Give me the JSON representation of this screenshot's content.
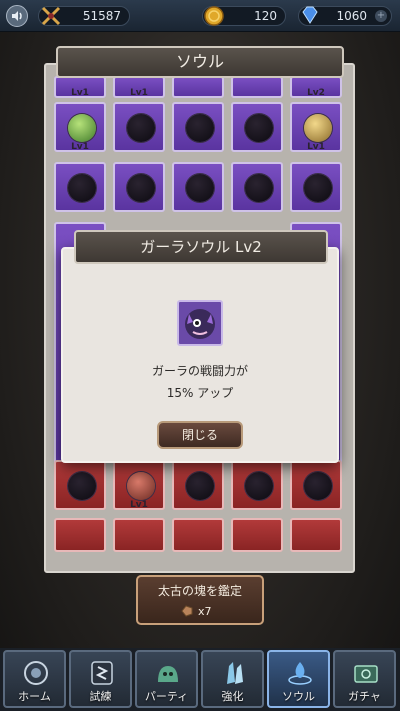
{
  "topbar": {
    "power": "51587",
    "gold": "120",
    "gems": "1060",
    "gem_plus": "+"
  },
  "panel": {
    "title": "ソウル"
  },
  "grid": {
    "lv_label": "Lv1",
    "lv2_label": "Lv2"
  },
  "modal": {
    "title": "ガーラソウル Lv2",
    "line1": "ガーラの戦闘力が",
    "line2": "15% アップ",
    "close_label": "閉じる"
  },
  "appraise": {
    "label": "太古の塊を鑑定",
    "count": "x7"
  },
  "nav": {
    "items": [
      {
        "label": "ホーム"
      },
      {
        "label": "試練"
      },
      {
        "label": "パーティ"
      },
      {
        "label": "強化"
      },
      {
        "label": "ソウル"
      },
      {
        "label": "ガチャ"
      }
    ]
  }
}
